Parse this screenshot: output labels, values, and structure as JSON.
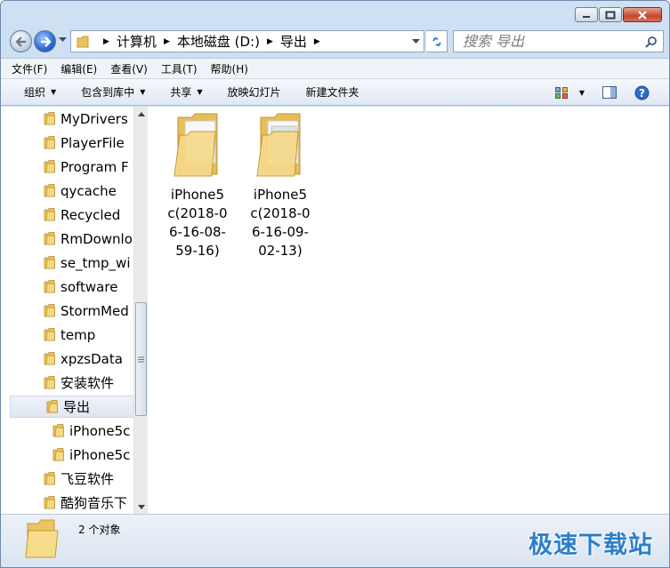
{
  "window": {
    "controls": {
      "minimize": "minimize",
      "maximize": "maximize",
      "close": "close"
    }
  },
  "address": {
    "breadcrumbs": [
      "计算机",
      "本地磁盘 (D:)",
      "导出"
    ]
  },
  "search": {
    "placeholder": "搜索 导出"
  },
  "menu": [
    "文件(F)",
    "编辑(E)",
    "查看(V)",
    "工具(T)",
    "帮助(H)"
  ],
  "toolbar": {
    "organize": "组织",
    "include_in_library": "包含到库中",
    "share": "共享",
    "slideshow": "放映幻灯片",
    "new_folder": "新建文件夹"
  },
  "nav_tree": [
    {
      "label": "MyDrivers"
    },
    {
      "label": "PlayerFile"
    },
    {
      "label": "Program F"
    },
    {
      "label": "qycache"
    },
    {
      "label": "Recycled"
    },
    {
      "label": "RmDownlo"
    },
    {
      "label": "se_tmp_wi"
    },
    {
      "label": "software"
    },
    {
      "label": "StormMed"
    },
    {
      "label": "temp"
    },
    {
      "label": "xpzsData"
    },
    {
      "label": "安装软件"
    },
    {
      "label": "导出",
      "selected": true
    },
    {
      "label": "iPhone5c",
      "child": true
    },
    {
      "label": "iPhone5c",
      "child": true
    },
    {
      "label": "飞豆软件"
    },
    {
      "label": "酷狗音乐下"
    }
  ],
  "files": [
    {
      "name": "iPhone5c(2018-06-16-08-59-16)",
      "lines": [
        "iPhone5",
        "c(2018-0",
        "6-16-08-",
        "59-16)"
      ]
    },
    {
      "name": "iPhone5c(2018-06-16-09-02-13)",
      "lines": [
        "iPhone5",
        "c(2018-0",
        "6-16-09-",
        "02-13)"
      ]
    }
  ],
  "status": {
    "count": "2 个对象",
    "watermark": "极速下载站"
  },
  "colors": {
    "accent": "#2b7fc9",
    "chrome": "#cfe0f2",
    "folder": "#f3d27a"
  }
}
